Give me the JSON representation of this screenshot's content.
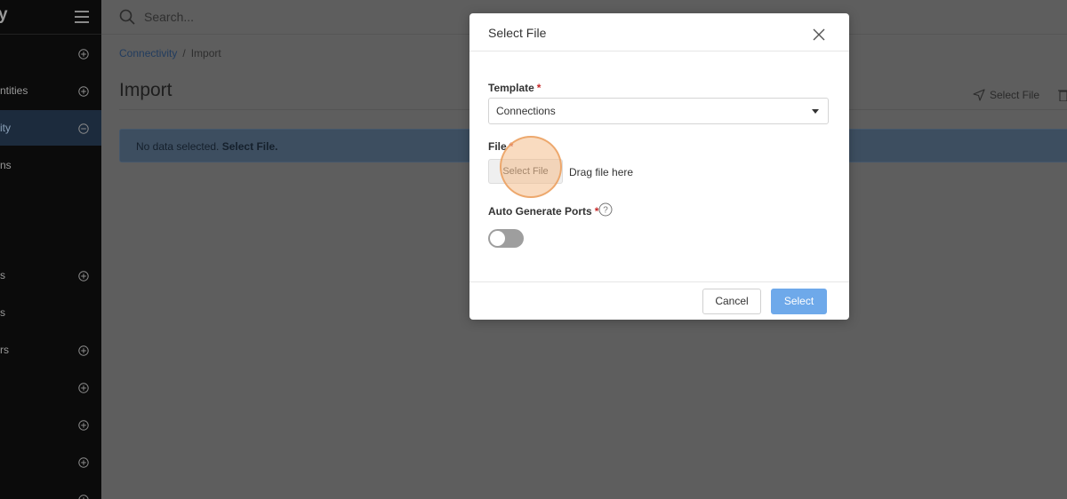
{
  "sidebar": {
    "brand": "y",
    "items": [
      {
        "label": "",
        "icon": "plus-circle-icon",
        "active": false
      },
      {
        "label": "ntities",
        "icon": "plus-circle-icon",
        "active": false
      },
      {
        "label": "ity",
        "icon": "minus-circle-icon",
        "active": true
      },
      {
        "label": "ns",
        "icon": "",
        "active": false
      },
      {
        "label": "s",
        "icon": "plus-circle-icon",
        "active": false
      },
      {
        "label": "s",
        "icon": "",
        "active": false
      },
      {
        "label": "rs",
        "icon": "plus-circle-icon",
        "active": false
      },
      {
        "label": "",
        "icon": "plus-circle-icon",
        "active": false
      },
      {
        "label": "",
        "icon": "plus-circle-icon",
        "active": false
      },
      {
        "label": "",
        "icon": "plus-circle-icon",
        "active": false
      },
      {
        "label": "",
        "icon": "plus-circle-icon",
        "active": false
      }
    ]
  },
  "topbar": {
    "search_placeholder": "Search..."
  },
  "breadcrumb": {
    "link": "Connectivity",
    "separator": "/",
    "current": "Import"
  },
  "page": {
    "title": "Import",
    "action_label": "Select File"
  },
  "alert": {
    "text": "No data selected.",
    "link": "Select File."
  },
  "modal": {
    "title": "Select File",
    "template_label": "Template",
    "template_value": "Connections",
    "file_label": "File",
    "file_button": "Select File",
    "drag_text": "Drag file here",
    "auto_ports_label": "Auto Generate Ports",
    "required_mark": "*",
    "toggle_on": false,
    "cancel_label": "Cancel",
    "select_label": "Select"
  },
  "colors": {
    "overlay": "#5e5e5e",
    "sidebar": "#0b0b0b",
    "primary": "#6ea9ea",
    "required": "#c62828",
    "highlight": "#f4be8c"
  }
}
